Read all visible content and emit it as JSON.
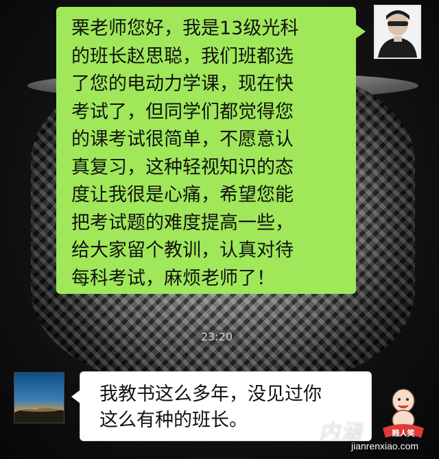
{
  "conversation": {
    "sent_message": {
      "text": "栗老师您好，我是13级光科\n的班长赵思聪，我们班都选\n了您的电动力学课，现在快\n考试了，但同学们都觉得您\n的课考试很简单，不愿意认\n真复习，这种轻视知识的态\n度让我很是心痛，希望您能\n把考试题的难度提高一些，\n给大家留个教训，认真对待\n每科考试，麻烦老师了！"
    },
    "timestamp": "23:20",
    "received_message": {
      "text": "我教书这么多年，没见过你\n这么有种的班长。"
    }
  },
  "watermark": {
    "script_text": "内涵",
    "logo_text": "贱人笑",
    "url": "jianrenxiao.com"
  },
  "colors": {
    "sent_bubble": "#a0e75a",
    "received_bubble": "#ffffff",
    "background": "#151515"
  },
  "icons": {
    "sender_avatar": "avatar-person-icon",
    "receiver_avatar": "avatar-landscape-icon",
    "watermark_logo": "cartoon-baby-icon"
  }
}
